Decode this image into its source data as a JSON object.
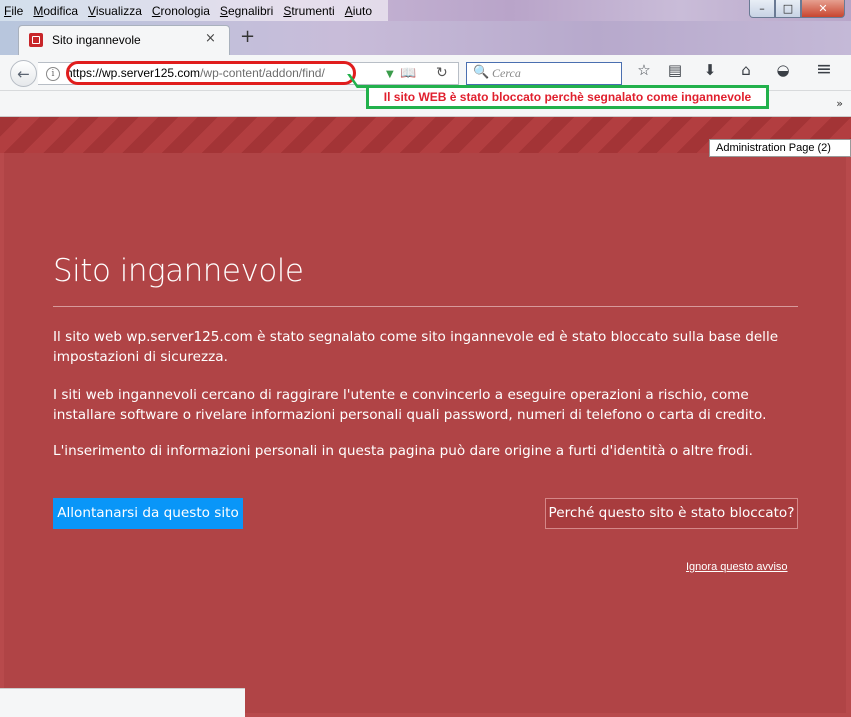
{
  "menu": [
    "File",
    "Modifica",
    "Visualizza",
    "Cronologia",
    "Segnalibri",
    "Strumenti",
    "Aiuto"
  ],
  "window_controls": {
    "minimize": "–",
    "maximize": "□",
    "close": "✕"
  },
  "tab": {
    "title": "Sito ingannevole",
    "close": "×",
    "new_tab": "+"
  },
  "navbar": {
    "back": "←",
    "info": "i",
    "url_host": "https://wp.server125.com",
    "url_path": "/wp-content/addon/find/",
    "search_placeholder": "Cerca"
  },
  "annotation": {
    "text": "Il sito WEB è stato bloccato perchè segnalato come ingannevole",
    "highlight_color": "#e01d1d",
    "note_border_color": "#22b14c"
  },
  "bookmarks": {
    "overflow": "»"
  },
  "page": {
    "tooltip": "Administration Page (2)",
    "title": "Sito ingannevole",
    "para1": "Il sito web wp.server125.com è stato segnalato come sito ingannevole ed è stato bloccato sulla base delle impostazioni di sicurezza.",
    "para2": "I siti web ingannevoli cercano di raggirare l'utente e convincerlo a eseguire operazioni a rischio, come installare software o rivelare informazioni personali quali password, numeri di telefono o carta di credito.",
    "para3": "L'inserimento di informazioni personali in questa pagina può dare origine a furti d'identità o altre frodi.",
    "button_leave": "Allontanarsi da questo sito",
    "button_why": "Perché questo sito è stato bloccato?",
    "ignore_link": "Ignora questo avviso",
    "background_color": "#b04446",
    "primary_button_color": "#0996f8"
  },
  "icons": {
    "reader": "📖",
    "reload": "↻",
    "search": "🔍",
    "bookmark_star": "☆",
    "library": "▤",
    "download": "⬇",
    "home": "⌂",
    "pocket": "◒",
    "menu": "≡",
    "drop_marker": "▼"
  }
}
